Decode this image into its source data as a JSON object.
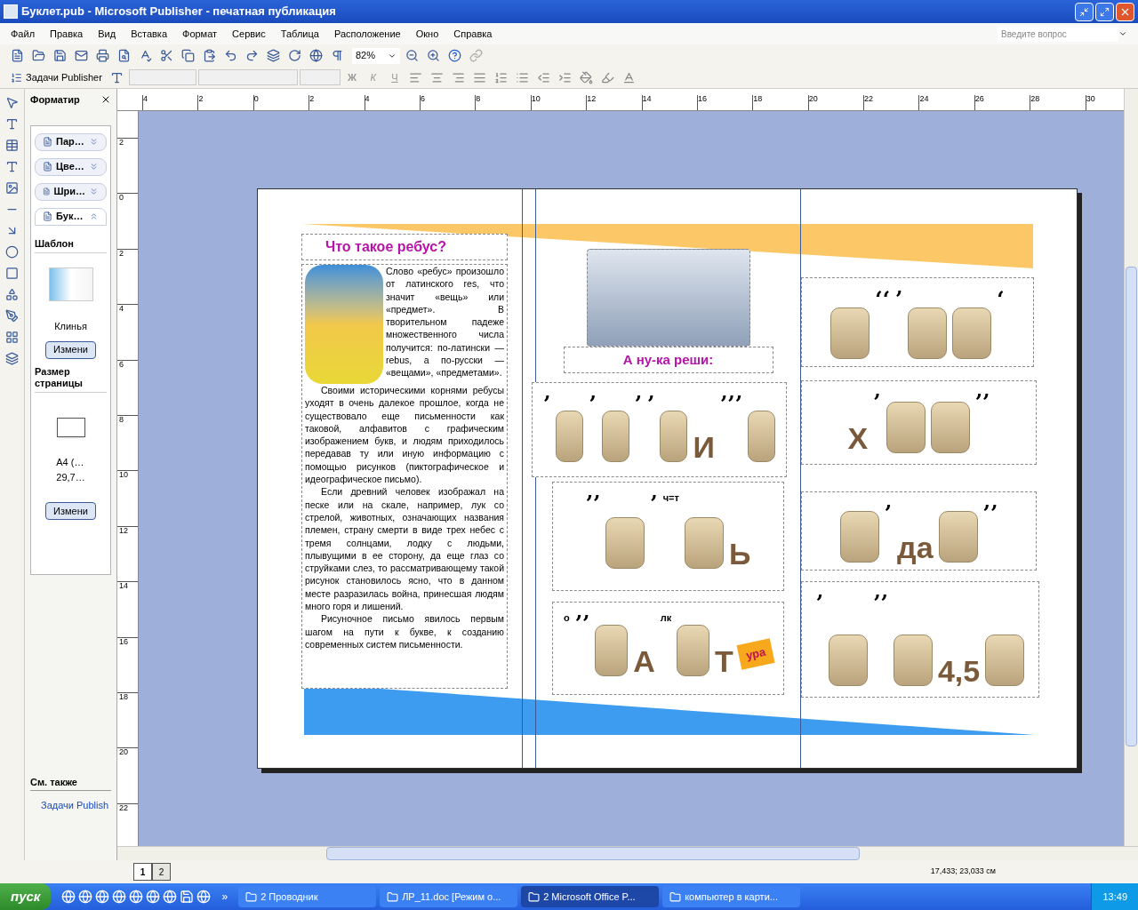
{
  "window": {
    "title": "Буклет.pub - Microsoft Publisher - печатная публикация"
  },
  "menu": [
    "Файл",
    "Правка",
    "Вид",
    "Вставка",
    "Формат",
    "Сервис",
    "Таблица",
    "Расположение",
    "Окно",
    "Справка"
  ],
  "help_box": {
    "placeholder": "Введите вопрос"
  },
  "toolbar": {
    "zoom": "82%"
  },
  "formatting_toolbar": {
    "tasks_button": "Задачи Publisher",
    "bold": "Ж",
    "italic": "К",
    "underline": "Ч"
  },
  "task_pane": {
    "title": "Форматир",
    "sections": [
      {
        "label": "Пар…",
        "expanded": false
      },
      {
        "label": "Цве…",
        "expanded": false
      },
      {
        "label": "Шри…",
        "expanded": false
      },
      {
        "label": "Бук…",
        "expanded": true
      }
    ],
    "template_heading": "Шаблон",
    "template_name": "Клинья",
    "template_button": "Измени",
    "size_heading": "Размер страницы",
    "size_name": [
      "A4 (…",
      "29,7…"
    ],
    "size_button": "Измени",
    "see_also": "См. также",
    "link": "Задачи Publish"
  },
  "ruler_horizontal": [
    "4",
    "2",
    "0",
    "2",
    "4",
    "6",
    "8",
    "10",
    "12",
    "14",
    "16",
    "18",
    "20",
    "22",
    "24",
    "26",
    "28",
    "30"
  ],
  "ruler_vertical": [
    "2",
    "0",
    "2",
    "4",
    "6",
    "8",
    "10",
    "12",
    "14",
    "16",
    "18",
    "20",
    "22"
  ],
  "page": {
    "left": {
      "heading": "Что такое ребус?",
      "paragraphs": [
        "Слово «ребус» произошло от латинского res, что значит «вещь» или «предмет». В творительном падеже множественного числа получится: по-латински — rebus, а по-русски — «вещами», «предметами».",
        "Своими историческими корнями ребусы уходят в очень далекое прошлое, когда не существовало еще письменности как таковой, алфавитов с графическим изображением букв, и людям приходилось передавав ту или иную информацию с помощью рисунков (пиктографическое и идеографическое письмо).",
        "Если древний человек изображал на песке или на скале, например, лук со стрелой, животных, означающих названия племен, страну смерти в виде трех небес с тремя солнцами, лодку с людьми, плывущими в ее сторону, да еще глаз со струйками слез, то рассматривающему такой рисунок становилось ясно, что в данном месте разразилась война, принесшая людям много горя и лишений.",
        "Рисуночное письмо явилось первым шагом на пути к букве, к созданию современных систем письменности."
      ]
    },
    "middle": {
      "heading": "А ну-ка реши:",
      "rebuses": [
        {
          "tokens": [
            {
              "kind": "mark",
              "text": "’"
            },
            {
              "kind": "pic"
            },
            {
              "kind": "mark",
              "text": "’"
            },
            {
              "kind": "pic"
            },
            {
              "kind": "mark",
              "text": "’"
            },
            {
              "kind": "mark",
              "text": "’"
            },
            {
              "kind": "pic"
            },
            {
              "kind": "letter",
              "text": "И"
            },
            {
              "kind": "mark",
              "text": "’’’"
            },
            {
              "kind": "pic"
            }
          ]
        },
        {
          "tokens": [
            {
              "kind": "mark",
              "text": "’’"
            },
            {
              "kind": "pic"
            },
            {
              "kind": "mark",
              "text": "’"
            },
            {
              "kind": "small",
              "text": "ч=т"
            },
            {
              "kind": "pic"
            },
            {
              "kind": "letter",
              "text": "Ь"
            }
          ]
        },
        {
          "tokens": [
            {
              "kind": "small",
              "text": "о"
            },
            {
              "kind": "mark",
              "text": "’’"
            },
            {
              "kind": "pic"
            },
            {
              "kind": "letter",
              "text": "А"
            },
            {
              "kind": "small",
              "text": "лк"
            },
            {
              "kind": "pic"
            },
            {
              "kind": "letter",
              "text": "Т"
            },
            {
              "kind": "flag",
              "text": "ура"
            }
          ]
        }
      ]
    },
    "right": {
      "rebuses": [
        {
          "tokens": [
            {
              "kind": "pic"
            },
            {
              "kind": "mark",
              "text": "‘‘"
            },
            {
              "kind": "mark",
              "text": "’"
            },
            {
              "kind": "pic"
            },
            {
              "kind": "pic"
            },
            {
              "kind": "mark",
              "text": "‘"
            }
          ]
        },
        {
          "tokens": [
            {
              "kind": "letter",
              "text": "Х"
            },
            {
              "kind": "mark",
              "text": "’"
            },
            {
              "kind": "pic"
            },
            {
              "kind": "pic"
            },
            {
              "kind": "mark",
              "text": "’’"
            }
          ]
        },
        {
          "tokens": [
            {
              "kind": "pic"
            },
            {
              "kind": "mark",
              "text": "’"
            },
            {
              "kind": "letter",
              "text": "да"
            },
            {
              "kind": "pic"
            },
            {
              "kind": "mark",
              "text": "’’"
            }
          ]
        },
        {
          "tokens": [
            {
              "kind": "mark",
              "text": "’"
            },
            {
              "kind": "pic"
            },
            {
              "kind": "mark",
              "text": "’’"
            },
            {
              "kind": "pic"
            },
            {
              "kind": "letter",
              "text": "4,5"
            },
            {
              "kind": "pic"
            }
          ]
        }
      ]
    }
  },
  "status_bar": {
    "pages": [
      {
        "label": "1",
        "selected": true
      },
      {
        "label": "2",
        "selected": false
      }
    ],
    "position": "17,433; 23,033 см"
  },
  "taskbar": {
    "start": "пуск",
    "more": "»",
    "tasks": [
      {
        "label": "2 Проводник",
        "selected": false
      },
      {
        "label": "ЛР_11.doc [Режим о...",
        "selected": false
      },
      {
        "label": "2 Microsoft Office P...",
        "selected": true
      },
      {
        "label": "компьютер в карти...",
        "selected": false
      }
    ],
    "clock": "13:49"
  }
}
